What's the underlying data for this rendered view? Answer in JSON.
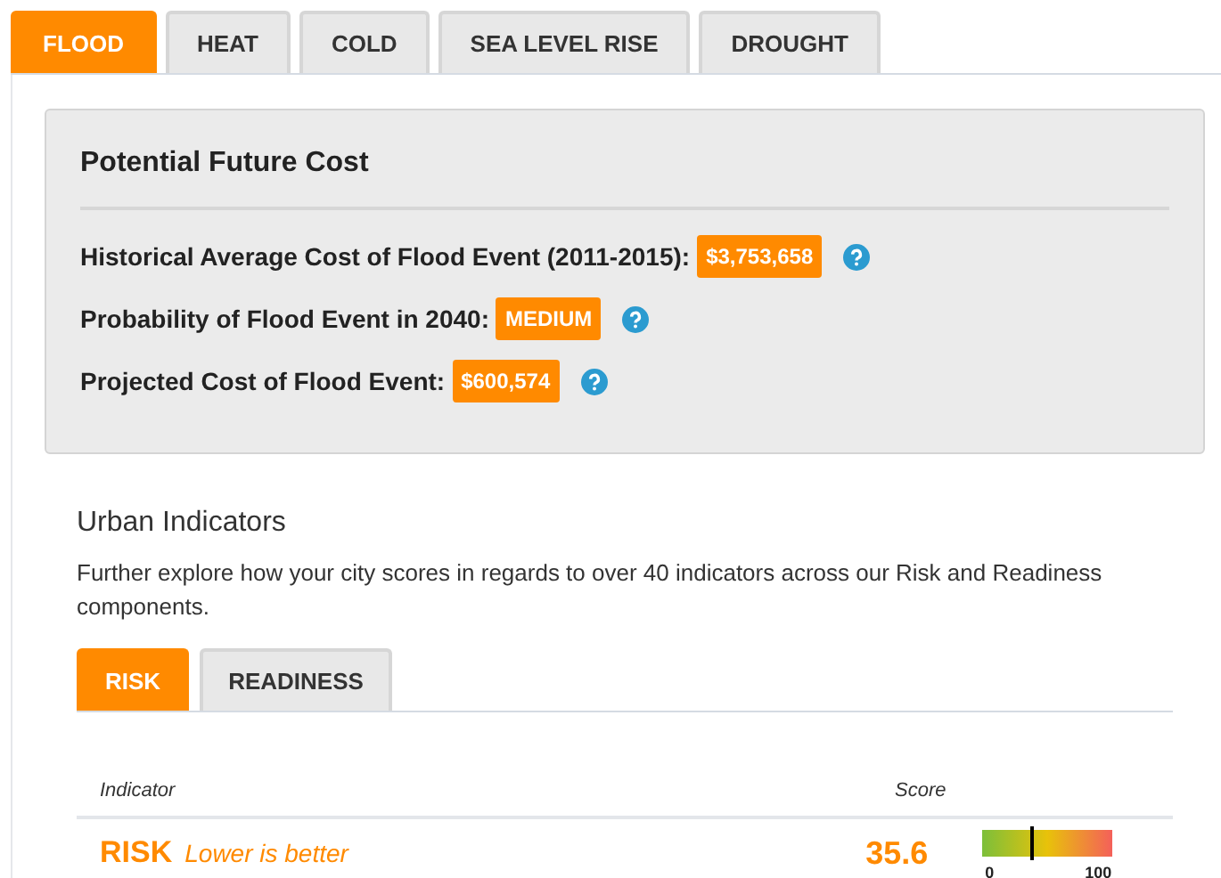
{
  "hazard_tabs": [
    {
      "label": "FLOOD",
      "selected": true
    },
    {
      "label": "HEAT",
      "selected": false
    },
    {
      "label": "COLD",
      "selected": false
    },
    {
      "label": "SEA LEVEL RISE",
      "selected": false
    },
    {
      "label": "DROUGHT",
      "selected": false
    }
  ],
  "cost_panel": {
    "title": "Potential Future Cost",
    "rows": [
      {
        "label": "Historical Average Cost of Flood Event (2011-2015):",
        "value": "$3,753,658"
      },
      {
        "label": "Probability of Flood Event in 2040:",
        "value": "MEDIUM"
      },
      {
        "label": "Projected Cost of Flood Event:",
        "value": "$600,574"
      }
    ]
  },
  "urban_indicators": {
    "title": "Urban Indicators",
    "description": "Further explore how your city scores in regards to over 40 indicators across our Risk and Readiness components.",
    "tabs": [
      {
        "label": "RISK",
        "selected": true
      },
      {
        "label": "READINESS",
        "selected": false
      }
    ],
    "table": {
      "columns": [
        "Indicator",
        "Score"
      ],
      "rows": [
        {
          "name": "RISK",
          "note": "Lower is better",
          "score": "35.6",
          "level": 0.38,
          "min_label": "0",
          "max_label": "100"
        }
      ]
    }
  }
}
